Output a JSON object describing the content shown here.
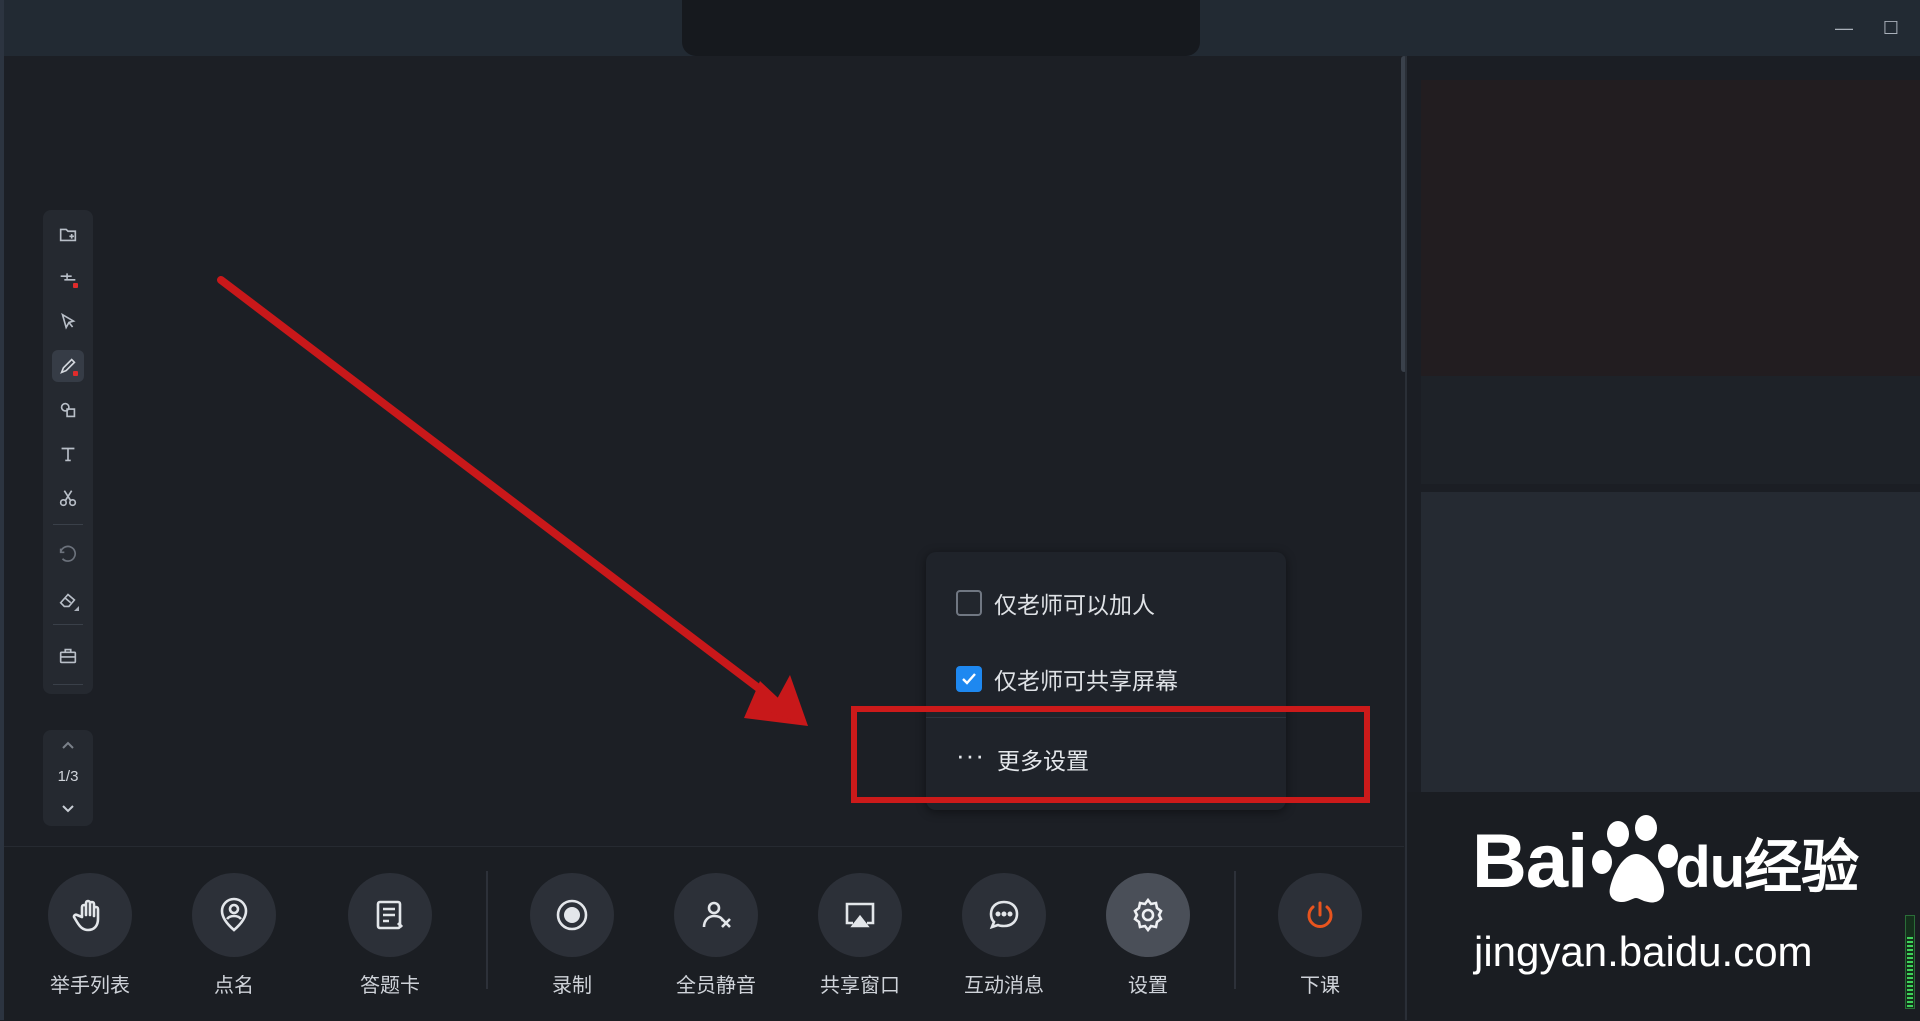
{
  "window": {
    "minimize_label": "—",
    "maximize_label": "☐"
  },
  "whiteboard_tools": [
    {
      "name": "add-page-icon"
    },
    {
      "name": "layers-icon"
    },
    {
      "name": "select-pointer-icon"
    },
    {
      "name": "pen-icon"
    },
    {
      "name": "shapes-icon"
    },
    {
      "name": "text-icon"
    },
    {
      "name": "scissors-icon"
    },
    {
      "name": "undo-icon"
    },
    {
      "name": "eraser-icon"
    },
    {
      "name": "toolbox-icon"
    }
  ],
  "pager": {
    "page_text": "1/3",
    "current": 1,
    "total": 3
  },
  "settings_popup": {
    "options": [
      {
        "label": "仅老师可以加人",
        "checked": false
      },
      {
        "label": "仅老师可共享屏幕",
        "checked": true
      }
    ],
    "more_dots": "···",
    "more_label": "更多设置"
  },
  "bottom_bar": {
    "buttons": [
      {
        "label": "举手列表",
        "icon": "raise-hand-icon"
      },
      {
        "label": "点名",
        "icon": "roll-call-icon"
      },
      {
        "label": "答题卡",
        "icon": "answer-card-icon"
      },
      {
        "label": "录制",
        "icon": "record-icon"
      },
      {
        "label": "全员静音",
        "icon": "mute-all-icon"
      },
      {
        "label": "共享窗口",
        "icon": "share-window-icon"
      },
      {
        "label": "互动消息",
        "icon": "chat-icon"
      },
      {
        "label": "设置",
        "icon": "gear-icon"
      },
      {
        "label": "下课",
        "icon": "power-icon"
      }
    ]
  },
  "watermark": {
    "logo_text": "Bai",
    "logo_suffix": "du经验",
    "url": "jingyan.baidu.com"
  },
  "colors": {
    "accent": "#1e88f0",
    "annotation": "#cc1a1a",
    "end_class": "#e8541e"
  }
}
